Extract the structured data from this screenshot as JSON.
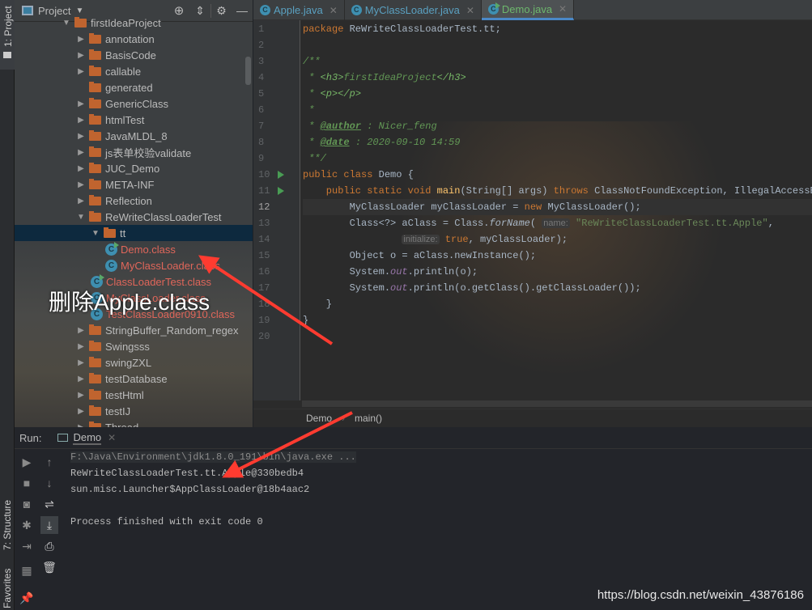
{
  "stripe": {
    "project": "1: Project",
    "structure": "7: Structure",
    "favorites": "Favorites"
  },
  "project_panel": {
    "title": "Project",
    "tree": [
      {
        "label": "firstIdeaProject",
        "type": "folder",
        "depth": 0,
        "expanded": true
      },
      {
        "label": "annotation",
        "type": "folder",
        "depth": 1,
        "expanded": false
      },
      {
        "label": "BasisCode",
        "type": "folder",
        "depth": 1,
        "expanded": false
      },
      {
        "label": "callable",
        "type": "folder",
        "depth": 1,
        "expanded": false
      },
      {
        "label": "generated",
        "type": "folder",
        "depth": 1,
        "leaf": true
      },
      {
        "label": "GenericClass",
        "type": "folder",
        "depth": 1,
        "expanded": false
      },
      {
        "label": "htmlTest",
        "type": "folder",
        "depth": 1,
        "expanded": false
      },
      {
        "label": "JavaMLDL_8",
        "type": "folder",
        "depth": 1,
        "expanded": false
      },
      {
        "label": "js表单校验validate",
        "type": "folder",
        "depth": 1,
        "expanded": false
      },
      {
        "label": "JUC_Demo",
        "type": "folder",
        "depth": 1,
        "expanded": false
      },
      {
        "label": "META-INF",
        "type": "folder",
        "depth": 1,
        "expanded": false
      },
      {
        "label": "Reflection",
        "type": "folder",
        "depth": 1,
        "expanded": false
      },
      {
        "label": "ReWriteClassLoaderTest",
        "type": "folder",
        "depth": 1,
        "expanded": true
      },
      {
        "label": "tt",
        "type": "folder",
        "depth": 2,
        "expanded": true,
        "selected": true
      },
      {
        "label": "Demo.class",
        "type": "class",
        "depth": 3,
        "runnable": true
      },
      {
        "label": "MyClassLoader.class",
        "type": "class",
        "depth": 3
      },
      {
        "label": "ClassLoaderTest.class",
        "type": "class",
        "depth": 2,
        "runnable": true
      },
      {
        "label": "MyClassLoader.class",
        "type": "class",
        "depth": 2
      },
      {
        "label": "TestClassLoader0910.class",
        "type": "class",
        "depth": 2
      },
      {
        "label": "StringBuffer_Random_regex",
        "type": "folder",
        "depth": 1,
        "expanded": false
      },
      {
        "label": "Swingsss",
        "type": "folder",
        "depth": 1,
        "expanded": false
      },
      {
        "label": "swingZXL",
        "type": "folder",
        "depth": 1,
        "expanded": false
      },
      {
        "label": "testDatabase",
        "type": "folder",
        "depth": 1,
        "expanded": false
      },
      {
        "label": "testHtml",
        "type": "folder",
        "depth": 1,
        "expanded": false
      },
      {
        "label": "testIJ",
        "type": "folder",
        "depth": 1,
        "expanded": false
      },
      {
        "label": "Thread",
        "type": "folder",
        "depth": 1,
        "expanded": false
      }
    ]
  },
  "annotation": "删除Apple.class",
  "editor": {
    "tabs": [
      {
        "label": "Apple.java",
        "active": false
      },
      {
        "label": "MyClassLoader.java",
        "active": false
      },
      {
        "label": "Demo.java",
        "active": true
      }
    ],
    "current_line": 12,
    "run_lines": [
      10,
      11
    ],
    "lines": [
      [
        [
          "kw",
          "package "
        ],
        [
          "",
          "ReWriteClassLoaderTest.tt;"
        ]
      ],
      [],
      [
        [
          "cm",
          "/**"
        ]
      ],
      [
        [
          "cm",
          " * "
        ],
        [
          "tag",
          "<h3>"
        ],
        [
          "cm",
          "firstIdeaProject"
        ],
        [
          "tag",
          "</h3>"
        ]
      ],
      [
        [
          "cm",
          " * "
        ],
        [
          "tag",
          "<p></p>"
        ]
      ],
      [
        [
          "cm",
          " *"
        ]
      ],
      [
        [
          "cm",
          " * "
        ],
        [
          "doc",
          "@author"
        ],
        [
          "cm",
          " : Nicer_feng"
        ]
      ],
      [
        [
          "cm",
          " * "
        ],
        [
          "doc",
          "@date"
        ],
        [
          "cm",
          " : 2020-09-10 14:59"
        ]
      ],
      [
        [
          "cm",
          " **/"
        ]
      ],
      [
        [
          "kw",
          "public class "
        ],
        [
          "",
          "Demo {"
        ]
      ],
      [
        [
          "kw",
          "    public static void "
        ],
        [
          "fn",
          "main"
        ],
        [
          "",
          "(String[] args) "
        ],
        [
          "kw",
          "throws "
        ],
        [
          "",
          "ClassNotFoundException, IllegalAccessException"
        ]
      ],
      [
        [
          "",
          "        MyClassLoader myClassLoader = "
        ],
        [
          "kw",
          "new "
        ],
        [
          "",
          "MyClassLoader();"
        ]
      ],
      [
        [
          "",
          "        Class<?> aClass = Class."
        ],
        [
          "it",
          "forName"
        ],
        [
          "",
          "( "
        ],
        [
          "hint",
          "name:"
        ],
        [
          "str",
          " \"ReWriteClassLoaderTest.tt.Apple\""
        ],
        [
          "",
          ","
        ]
      ],
      [
        [
          "",
          "                 "
        ],
        [
          "hint",
          "initialize:"
        ],
        [
          "kw",
          " true"
        ],
        [
          "",
          ", myClassLoader);"
        ]
      ],
      [
        [
          "",
          "        Object o = aClass.newInstance();"
        ]
      ],
      [
        [
          "",
          "        System."
        ],
        [
          "st",
          "out"
        ],
        [
          "",
          ".println(o);"
        ]
      ],
      [
        [
          "",
          "        System."
        ],
        [
          "st",
          "out"
        ],
        [
          "",
          ".println(o.getClass().getClassLoader());"
        ]
      ],
      [
        [
          "",
          "    }"
        ]
      ],
      [
        [
          "",
          "}"
        ]
      ],
      []
    ],
    "breadcrumb": [
      "Demo",
      "main()"
    ]
  },
  "run": {
    "label": "Run:",
    "tab": "Demo",
    "output": [
      {
        "text": "F:\\Java\\Environment\\jdk1.8.0_191\\bin\\java.exe ...",
        "dim": true
      },
      {
        "text": "ReWriteClassLoaderTest.tt.Apple@330bedb4"
      },
      {
        "text": "sun.misc.Launcher$AppClassLoader@18b4aac2"
      },
      {
        "text": ""
      },
      {
        "text": "Process finished with exit code 0"
      }
    ]
  },
  "watermark": "https://blog.csdn.net/weixin_43876186",
  "colors": {
    "accent": "#4a88c7",
    "keyword": "#cc7832",
    "string": "#6a8759",
    "arrow": "#ff3b30",
    "folder": "#c0642f"
  }
}
